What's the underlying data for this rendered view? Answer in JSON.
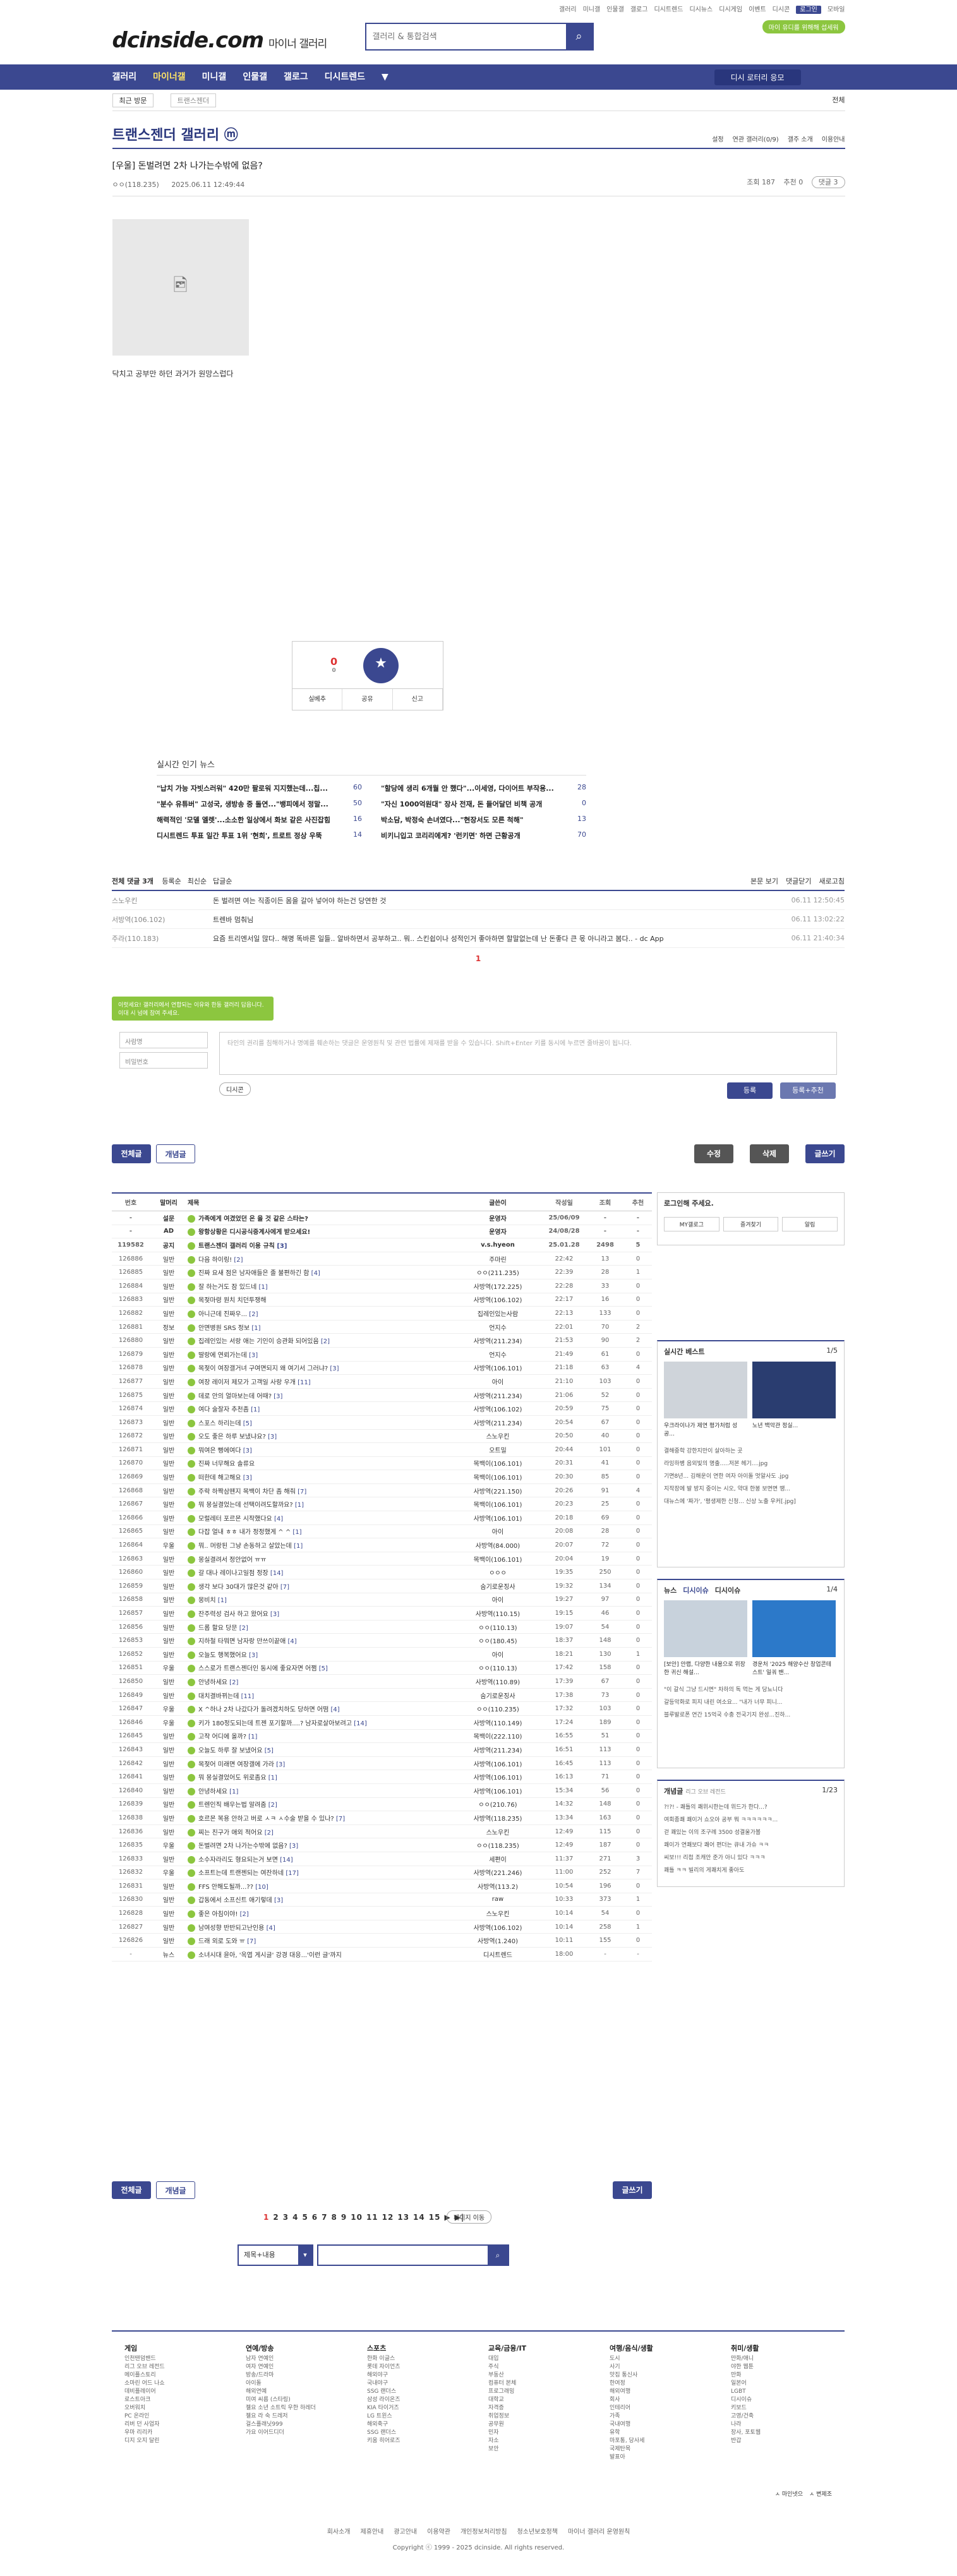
{
  "util_links": [
    "갤러리",
    "미니갤",
    "인물갤",
    "갤로그",
    "디시트렌드",
    "디시뉴스",
    "디시게임",
    "이벤트",
    "디시콘",
    "로그인",
    "모바일"
  ],
  "header": {
    "logo": "dcinside.com",
    "logo_sub": "마이너 갤러리",
    "search_placeholder": "갤러리 & 통합검색",
    "promo": "마이 유디를 위해해 섭세워"
  },
  "gnb": [
    "갤러리",
    "마이너갤",
    "미니갤",
    "인물갤",
    "갤로그",
    "디시트렌드",
    "▼"
  ],
  "gnb_right": "디시 로터리 응모",
  "sub": {
    "left": "최근 방문",
    "crumb": "트랜스젠더",
    "right": "전체"
  },
  "gallery": {
    "title": "트랜스젠더 갤러리 ⓜ",
    "opts": [
      "설정",
      "연관 갤러리(0/9)",
      "갤주 소개",
      "이용안내"
    ]
  },
  "post": {
    "title": "[우울] 돈벌려면 2차 나가는수밖에 없음?",
    "author": "ㅇㅇ(118.235)",
    "date": "2025.06.11 12:49:44",
    "views": "조회 187",
    "rec": "추천 0",
    "cmt_btn": "댓글 3",
    "body": "닥치고 공부만 하던 과거가 원망스럽다"
  },
  "recommend": {
    "up": "0",
    "up_sub": "0",
    "bar": [
      "실베추",
      "공유",
      "신고"
    ],
    "star": "개념"
  },
  "news": {
    "title": "실시간 인기 뉴스",
    "items": [
      {
        "t": "\"납치 가능 자빗스러워\" 420만 팔로워 지지했는데...칩...",
        "c": "60"
      },
      {
        "t": "\"할당에 생리 6개월 안 했다\"...이세영, 다이어트 부작용...",
        "c": "28"
      },
      {
        "t": "\"분수 유튜버\" 고성국, 생방송 중 돌연...\"뱅피에서 정말...",
        "c": "50"
      },
      {
        "t": "\"자신 1000억원대\" 장사 전재, 돈 들어달던 비책 공개",
        "c": "0"
      },
      {
        "t": "해력적인 '모델 엘렛'...소소한 일상에서 화보 같은 사진잡힘",
        "c": "16"
      },
      {
        "t": "박소담, 박정숙 손녀였다...\"현장서도 모른 척해\"",
        "c": "13"
      },
      {
        "t": "디시트렌드 투표 일간 투표 1위 '현희', 트로트 정상 우뚝",
        "c": "14"
      },
      {
        "t": "비키니입고 코리리에게? '런키면' 하면 근황공개",
        "c": "70"
      }
    ]
  },
  "comments": {
    "header": "전체 댓글 3개",
    "sort": [
      "등록순",
      "최신순",
      "답글순"
    ],
    "right": [
      "본문 보기",
      "댓글닫기",
      "새로고침"
    ],
    "rows": [
      {
        "n": "스노우킨",
        "c": "돈 벌려면 여는 직종이든 몸을 갈아 넣어야 하는건 당연한 것",
        "d": "06.11 12:50:45"
      },
      {
        "n": "서방역(106.102)",
        "c": "트렌바 멈춰님",
        "d": "06.11 13:02:22"
      },
      {
        "n": "주라(110.183)",
        "c": "요즘 트리엔서일 많다.. 해명 똑바른 일들.. 알바하면서 공부하고.. 뭐.. 스킨쉽이나 성적인거 좋아하면 할말없는데 난 돈좋다 큰 몫 아니라고 봄다.. - dc App",
        "d": "06.11 21:40:34"
      }
    ],
    "page": "1"
  },
  "write": {
    "tip": "이럿세요! 갤러리에서 연합되는 이유와 한동 갤러리 답읍니다. 이대 시 넘에 참여 주세요.",
    "name": "사람명",
    "pw": "비밀번호",
    "text": "타인의 권리를 침해하거나 명예를 훼손하는 댓글은 운영원칙 및 관련 법률에 제재를 받을 수 있습니다. Shift+Enter 키를 동시에 누르면 줄바꿈이 됩니다.",
    "dccon": "디시콘",
    "submit": "등록",
    "submit2": "등록+추천"
  },
  "btns": {
    "all": "전체글",
    "good": "개념글",
    "edit": "수정",
    "del": "삭제",
    "write": "글쓰기"
  },
  "list": {
    "cols": [
      "번호",
      "말머리",
      "제목",
      "글쓴이",
      "작성일",
      "조회",
      "추천"
    ],
    "rows": [
      [
        "-",
        "설문",
        "가족에게 여겼었던 온 을 것 같은 스타는?",
        "",
        "운영자",
        "25/06/09",
        "-",
        "-"
      ],
      [
        "-",
        "AD",
        "왕항상황은 디시공식중계사에게 받으세요!",
        "",
        "운영자",
        "24/08/28",
        "-",
        "-"
      ],
      [
        "119582",
        "공지",
        "트랜스젠더 갤러리 이용 규칙",
        "3",
        "v.s.hyeon",
        "25.01.28",
        "2498",
        "5"
      ],
      [
        "126886",
        "일반",
        "다음 하이링!",
        "2",
        "주마린",
        "22:42",
        "13",
        "0"
      ],
      [
        "126885",
        "일반",
        "진짜 요새 점은 남자애들은 졸 불편하긴 함",
        "4",
        "ㅇㅇ(211.235)",
        "22:39",
        "28",
        "1"
      ],
      [
        "126884",
        "일반",
        "잘 하는거도 잠 있드네",
        "1",
        "사방역(172.225)",
        "22:28",
        "33",
        "0"
      ],
      [
        "126883",
        "일반",
        "목젖마령 원치 치던투쟁해",
        "",
        "사방역(106.102)",
        "22:17",
        "16",
        "0"
      ],
      [
        "126882",
        "일반",
        "아니근데 진짜우...",
        "2",
        "집레인있는사람",
        "22:13",
        "133",
        "0"
      ],
      [
        "126881",
        "정보",
        "안면병원 SRS 정보",
        "1",
        "언지수",
        "22:01",
        "70",
        "2"
      ],
      [
        "126880",
        "일반",
        "집레인있는 서랑 애는 기인이 승관화 되어있음",
        "2",
        "사방역(211.234)",
        "21:53",
        "90",
        "2"
      ],
      [
        "126879",
        "일반",
        "딸랑에 연뢰가는데",
        "3",
        "언지수",
        "21:49",
        "61",
        "0"
      ],
      [
        "126878",
        "일반",
        "목젖이 여장갤거녀 구여면되지 왜 여기서 그러냐?",
        "3",
        "사방역(106.101)",
        "21:18",
        "63",
        "4"
      ],
      [
        "126877",
        "일반",
        "여장 레이저 제모가 고객일 사랑 우개",
        "11",
        "아이",
        "21:10",
        "103",
        "0"
      ],
      [
        "126875",
        "일반",
        "데로 안의 얼마보는데 어때?",
        "3",
        "사방역(211.234)",
        "21:06",
        "52",
        "0"
      ],
      [
        "126874",
        "일반",
        "여다 술잘자 추천좀",
        "1",
        "사방역(106.102)",
        "20:59",
        "75",
        "0"
      ],
      [
        "126873",
        "일반",
        "스포스 하리는데",
        "5",
        "사방역(211.234)",
        "20:54",
        "67",
        "0"
      ],
      [
        "126872",
        "일반",
        "오도 좋은 하루 보냈냐요?",
        "3",
        "스노우킨",
        "20:50",
        "40",
        "0"
      ],
      [
        "126871",
        "일반",
        "뭐여은 뻥에여다",
        "3",
        "오트밀",
        "20:44",
        "101",
        "0"
      ],
      [
        "126870",
        "일반",
        "진짜 너무해요 솔류요",
        "",
        "목백이(106.101)",
        "20:31",
        "41",
        "0"
      ],
      [
        "126869",
        "일반",
        "떠한데 해고해요",
        "3",
        "목백이(106.101)",
        "20:30",
        "85",
        "0"
      ],
      [
        "126868",
        "일반",
        "주락 하짝삼뗀지 목백이 차단 좀 해줘",
        "7",
        "사방역(221.150)",
        "20:26",
        "91",
        "4"
      ],
      [
        "126867",
        "일반",
        "뭐 몽실결었는데 선택이려도할까요?",
        "1",
        "목백이(106.101)",
        "20:23",
        "25",
        "0"
      ],
      [
        "126866",
        "일반",
        "모럴레터 포르몬 시작했다요",
        "4",
        "사방역(106.101)",
        "20:18",
        "69",
        "0"
      ],
      [
        "126865",
        "일반",
        "다잡 얼내 ㅎㅎ 내가 정정했게 ^ ^",
        "1",
        "아이",
        "20:08",
        "28",
        "0"
      ],
      [
        "126864",
        "우울",
        "뭐.. 머랑된 그냥 손동하고 살았는데",
        "1",
        "사방역(84.000)",
        "20:07",
        "72",
        "0"
      ],
      [
        "126863",
        "일반",
        "몽실결려서 정안없어 ㅠㅠ",
        "",
        "목백이(106.101)",
        "20:04",
        "19",
        "0"
      ],
      [
        "126860",
        "일반",
        "갈 대나 레이나고일점 정장",
        "14",
        "ㅇㅇㅇ",
        "19:35",
        "250",
        "0"
      ],
      [
        "126859",
        "일반",
        "생각 보다 30대가 많은것 같아",
        "7",
        "숨기로운징사",
        "19:32",
        "134",
        "0"
      ],
      [
        "126858",
        "일반",
        "몽비치",
        "1",
        "아이",
        "19:27",
        "97",
        "0"
      ],
      [
        "126857",
        "일반",
        "잔주력성 검사 하고 왔어요",
        "3",
        "사방역(110.15)",
        "19:15",
        "46",
        "0"
      ],
      [
        "126856",
        "일반",
        "드롭 할요 당문",
        "2",
        "ㅇㅇ(110.13)",
        "19:07",
        "54",
        "0"
      ],
      [
        "126853",
        "일반",
        "지하철 타뭐면 남자랑 만쓰이끝애",
        "4",
        "ㅇㅇ(180.45)",
        "18:37",
        "148",
        "0"
      ],
      [
        "126852",
        "일반",
        "오늘도 행복했어요",
        "3",
        "아이",
        "18:21",
        "130",
        "1"
      ],
      [
        "126851",
        "우울",
        "스스로가 트랜스젠더인 동시에 좋요자면 어쩜",
        "5",
        "ㅇㅇ(110.13)",
        "17:42",
        "158",
        "0"
      ],
      [
        "126850",
        "일반",
        "안녕하세요",
        "2",
        "사방역(110.89)",
        "17:39",
        "67",
        "0"
      ],
      [
        "126849",
        "일반",
        "대치결바뀌는데",
        "11",
        "숨기로운징사",
        "17:38",
        "73",
        "0"
      ],
      [
        "126847",
        "우울",
        "X ^하나 2차 나갔다가 돌려겠치하도 당하면 어떰",
        "4",
        "ㅇㅇ(110.235)",
        "17:32",
        "103",
        "0"
      ],
      [
        "126846",
        "우울",
        "키가 180정도되는데 트젠 포기할까....? 남자로살아보려고",
        "14",
        "사방역(110.149)",
        "17:24",
        "189",
        "0"
      ],
      [
        "126845",
        "일반",
        "고작 어디에 올까?",
        "1",
        "목백이(222.110)",
        "16:55",
        "51",
        "0"
      ],
      [
        "126843",
        "일반",
        "오늘도 하루 잘 보냈어요",
        "5",
        "사방역(211.234)",
        "16:51",
        "113",
        "0"
      ],
      [
        "126842",
        "일반",
        "목젖어 미래면 여장갤에 가라",
        "3",
        "사방역(106.101)",
        "16:45",
        "113",
        "0"
      ],
      [
        "126841",
        "일반",
        "뭐 몽실결었어도 위로좀요",
        "1",
        "사방역(106.101)",
        "16:13",
        "71",
        "0"
      ],
      [
        "126840",
        "일반",
        "안녕하세요",
        "1",
        "사방역(106.101)",
        "15:34",
        "56",
        "0"
      ],
      [
        "126839",
        "일반",
        "트렌인직 배우는법 알려줌",
        "2",
        "ㅇㅇ(210.76)",
        "14:32",
        "148",
        "0"
      ],
      [
        "126838",
        "일반",
        "호르몬 복용 안하고 버로 ㅅㅋ ㅅ수술 받을 수 있나?",
        "7",
        "사방역(118.235)",
        "13:34",
        "163",
        "0"
      ],
      [
        "126836",
        "일반",
        "찌는 친구가 애외 적어요",
        "2",
        "스노우킨",
        "12:49",
        "115",
        "0"
      ],
      [
        "126835",
        "우울",
        "돈벌려면 2차 나가는수밖에 없음?",
        "3",
        "ㅇㅇ(118.235)",
        "12:49",
        "187",
        "0"
      ],
      [
        "126833",
        "일반",
        "소수자라리도 형요되는거 보면",
        "14",
        "세편이",
        "11:37",
        "271",
        "3"
      ],
      [
        "126832",
        "우울",
        "소프트는데 트랜젠되는 여잔하네",
        "17",
        "사방역(221.246)",
        "11:00",
        "252",
        "7"
      ],
      [
        "126831",
        "일반",
        "FFS 안해도될까...??",
        "10",
        "사방역(113.2)",
        "10:54",
        "196",
        "0"
      ],
      [
        "126830",
        "일반",
        "갑동에서 소프신트 애기렇데",
        "3",
        "raw",
        "10:33",
        "373",
        "1"
      ],
      [
        "126828",
        "일반",
        "좋은 아침이야!",
        "2",
        "스노우킨",
        "10:14",
        "54",
        "0"
      ],
      [
        "126827",
        "일반",
        "남여성향 반반되고난인용",
        "4",
        "사방역(106.102)",
        "10:14",
        "258",
        "1"
      ],
      [
        "126826",
        "일반",
        "드래 외로 도와 ㅠ",
        "7",
        "사방역(1.240)",
        "10:11",
        "155",
        "0"
      ],
      [
        "-",
        "뉴스",
        "소녀시대 윤아, '옥엽 게시글' 강경 대응...'이런 글'까지",
        "",
        "디시트렌드",
        "18:00",
        "-",
        "-"
      ]
    ]
  },
  "pager": {
    "pages": [
      "1",
      "2",
      "3",
      "4",
      "5",
      "6",
      "7",
      "8",
      "9",
      "10",
      "11",
      "12",
      "13",
      "14",
      "15"
    ],
    "next": "▶",
    "last": "▶|",
    "jump": "페이지 이동"
  },
  "list_search": {
    "select": "제목+내용",
    "placeholder": ""
  },
  "sidebar": {
    "login": {
      "title": "로그인해 주세요.",
      "btns": [
        "MY갤로그",
        "즐겨찾기",
        "알림"
      ]
    },
    "best": {
      "title": "실시간 베스트",
      "page": "1/5",
      "captions": [
        "우크라이나가 제연 평가처럼 성공...",
        "노년 백악관 정실..."
      ],
      "items": [
        "결해중학 강한지만이 살아하는 곳",
        "라잉하병 음외빛의 명출.....저본 헤기....jpg",
        "기면8년... 김해운이 연한 여자 아이돌 멋알사도 .jpg",
        "지작장에 발 방지 중이는 시오, 약대 한봉 보면면 땡...",
        "대뉴스에 '짜가', '평생제한 신청... 신상 노출 우커[.jpg]"
      ]
    },
    "news": {
      "tabs": [
        "뉴스",
        "디시이슈",
        "디시이슈"
      ],
      "page": "1/4",
      "captions": [
        "[보안] 안랩, 다양한 내용으로 위장한 귀신 해설...",
        "경운처 '2025 해양수산 창업콘테스트' 일궈 밴..."
      ],
      "items": [
        "\"이 갈식 그냥 드시면\" 차하의 독 먹는 게 당뇨니다",
        "갈등악화로 피지 내린 여소요... \"내가 너무 피니...",
        "블루발로폰 연간 15억국 수충 전국기지 완성...진하..."
      ]
    },
    "concept": {
      "title": "개념글",
      "sub": "리그 오브 레전드",
      "page": "1/23",
      "items": [
        "?!?! - 쾌틀의 쾌위시한는데 위드가 한다...?",
        "여회종쾌 쾌이거 쇼오아 공부 뭐 ㅋㅋㅋㅋㅋㅋ...",
        "걷 쾌있는 이의 조구례 3500 성결울가볼",
        "쾌이가 연쾌보다 쾌어 편더는 큐내 가슈 ㅋㅋ",
        "씨보!!! 리첩 조캐안 준가 아니 있다 ㅋㅋㅋ",
        "쾌틀 ㅋㅋ 빌리의 게쾌치게 좋아도"
      ]
    }
  },
  "footer": {
    "cols": [
      {
        "h": "게임",
        "items": [
          "인천탠덤밴드",
          "리그 오브 레전드",
          "메이플스토리",
          "소마린 어드 나쇼",
          "데비플레이어",
          "로스트아크",
          "오버워치",
          "PC 온라인",
          "리버 던 사업자",
          "우마 리리카",
          "디지 오지 달린"
        ]
      },
      {
        "h": "연예/방송",
        "items": [
          "남자 연예인",
          "여자 연예인",
          "방송/드라마",
          "아이돌",
          "해외연예",
          "미여 씨름 (스타링)",
          "젤요 소년 소트릭 우한 하레더",
          "젤요 라 숙 드레저",
          "걸스플래닛999",
          "가요 이어드디더"
        ]
      },
      {
        "h": "스포츠",
        "items": [
          "한화 이글스",
          "롯데 자이언츠",
          "해외야구",
          "국내야구",
          "SSG 랜더스",
          "삼성 라이온즈",
          "KIA 타이거즈",
          "LG 트윈스",
          "해외축구",
          "SSG 랜더스",
          "키움 히어로즈"
        ]
      },
      {
        "h": "교육/금융/IT",
        "items": [
          "대입",
          "주식",
          "부동산",
          "컴퓨터 본체",
          "프로그래밍",
          "대학교",
          "자격증",
          "취업정보",
          "공무원",
          "민자",
          "자소",
          "보안"
        ]
      },
      {
        "h": "여행/음식/생활",
        "items": [
          "도시",
          "사기",
          "맛집 통신사",
          "한여정",
          "해외여행",
          "회사",
          "인테리어",
          "가족",
          "국내여행",
          "유학",
          "마포통, 당사세",
          "국제탄목",
          "발표아"
        ]
      },
      {
        "h": "취미/생활",
        "items": [
          "만화/애니",
          "야한 웹툰",
          "만화",
          "일본어",
          "LGBT",
          "디시이슈",
          "키보드",
          "고영/건축",
          "나라",
          "장사, 포토웹",
          "반갑"
        ]
      }
    ],
    "right": [
      "ㅅ 마인넷으",
      "ㅅ 변제조"
    ],
    "links": [
      "회사소개",
      "제휴안내",
      "광고안내",
      "이용약관",
      "개인정보처리방침",
      "청소년보호정책",
      "마이너 갤러리 운영원칙"
    ],
    "copy": "Copyright ⓒ 1999 - 2025 dcinside. All rights reserved."
  },
  "colors": {
    "brand": "#3b4890",
    "green": "#8cc63f"
  }
}
